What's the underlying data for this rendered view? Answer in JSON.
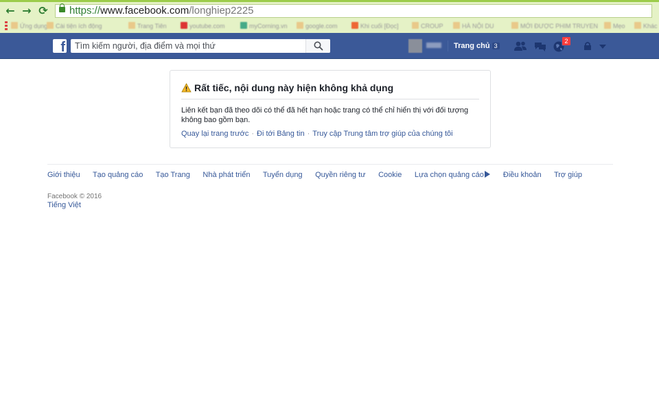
{
  "browser": {
    "url_scheme": "https://",
    "url_host": "www.facebook.com",
    "url_path": "/longhiep2225",
    "back_glyph": "←",
    "forward_glyph": "→",
    "reload_glyph": "⟳",
    "bookmarks": [
      "Ứng dụng",
      "Cài tiện ích động",
      "Trang Tiên",
      "youtube.com",
      "myCorning.vn",
      "google.com",
      "Khi cuối [Đọc]",
      "CROUP",
      "HÀ NỘI DU",
      "MỚI ĐƯỢC PHIM TRUYEN",
      "Mẹo",
      "Khác"
    ]
  },
  "header": {
    "search_placeholder": "Tìm kiếm người, địa điểm và mọi thứ",
    "home_label": "Trang chủ",
    "home_count": "3",
    "notification_count": "2",
    "colors": {
      "bar": "#3b5998",
      "badge": "#fa3e3e"
    }
  },
  "error_box": {
    "title": "Rất tiếc, nội dung này hiện không khả dụng",
    "message": "Liên kết bạn đã theo dõi có thể đã hết hạn hoặc trang có thể chỉ hiển thị với đối tượng không bao gồm bạn.",
    "links": [
      "Quay lại trang trước",
      "Đi tới Bảng tin",
      "Truy cập Trung tâm trợ giúp của chúng tôi"
    ]
  },
  "footer": {
    "links": [
      "Giới thiệu",
      "Tạo quảng cáo",
      "Tạo Trang",
      "Nhà phát triển",
      "Tuyển dụng",
      "Quyền riêng tư",
      "Cookie",
      "Lựa chọn quảng cáo",
      "Điều khoản",
      "Trợ giúp"
    ],
    "copyright": "Facebook © 2016",
    "language": "Tiếng Việt"
  }
}
